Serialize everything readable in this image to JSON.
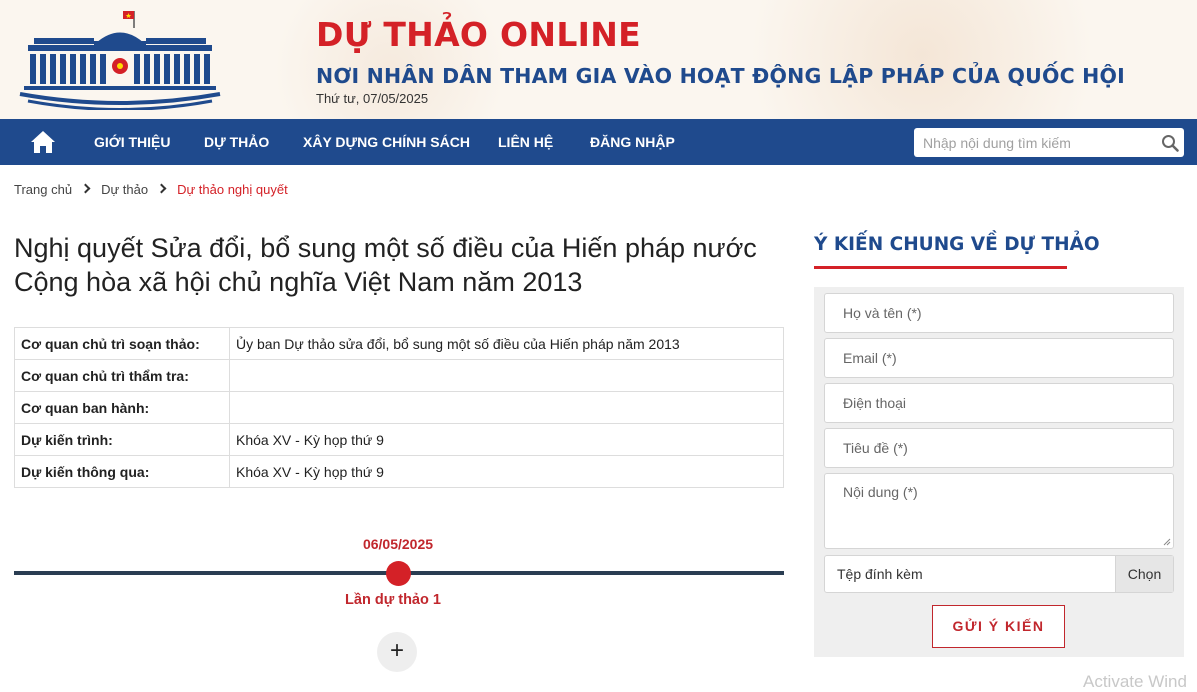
{
  "header": {
    "title": "DỰ THẢO ONLINE",
    "subtitle": "NƠI NHÂN DÂN THAM GIA VÀO HOẠT ĐỘNG LẬP PHÁP CỦA QUỐC HỘI",
    "date": "Thứ tư, 07/05/2025"
  },
  "nav": {
    "items": [
      "GIỚI THIỆU",
      "DỰ THẢO",
      "XÂY DỰNG CHÍNH SÁCH",
      "LIÊN HỆ",
      "ĐĂNG NHẬP"
    ],
    "search_placeholder": "Nhập nội dung tìm kiếm"
  },
  "breadcrumb": [
    "Trang chủ",
    "Dự thảo",
    "Dự thảo nghị quyết"
  ],
  "document": {
    "title": "Nghị quyết Sửa đổi, bổ sung một số điều của Hiến pháp nước Cộng hòa xã hội chủ nghĩa Việt Nam năm 2013",
    "info": [
      {
        "label": "Cơ quan chủ trì soạn thảo:",
        "value": "Ủy ban Dự thảo sửa đổi, bổ sung một số điều của Hiến pháp năm 2013"
      },
      {
        "label": "Cơ quan chủ trì thẩm tra:",
        "value": ""
      },
      {
        "label": "Cơ quan ban hành:",
        "value": ""
      },
      {
        "label": "Dự kiến trình:",
        "value": "Khóa XV - Kỳ họp thứ 9"
      },
      {
        "label": "Dự kiến thông qua:",
        "value": "Khóa XV - Kỳ họp thứ 9"
      }
    ]
  },
  "timeline": {
    "date": "06/05/2025",
    "label": "Lần dự thảo 1",
    "expand": "+"
  },
  "feedback": {
    "title": "Ý KIẾN CHUNG VỀ DỰ THẢO",
    "name_placeholder": "Họ và tên (*)",
    "email_placeholder": "Email (*)",
    "phone_placeholder": "Điện thoại",
    "subject_placeholder": "Tiêu đề (*)",
    "content_placeholder": "Nội dung (*)",
    "attachment_label": "Tệp đính kèm",
    "choose_label": "Chọn",
    "submit_label": "GỬI Ý KIẾN"
  },
  "watermark": "Activate Wind",
  "colors": {
    "brand_red": "#d42127",
    "brand_blue": "#1f4a8d",
    "timeline_bar": "#2a3d52"
  },
  "icons": [
    "home-icon",
    "search-icon",
    "national-assembly-logo",
    "chevron-right-icon",
    "plus-icon"
  ]
}
